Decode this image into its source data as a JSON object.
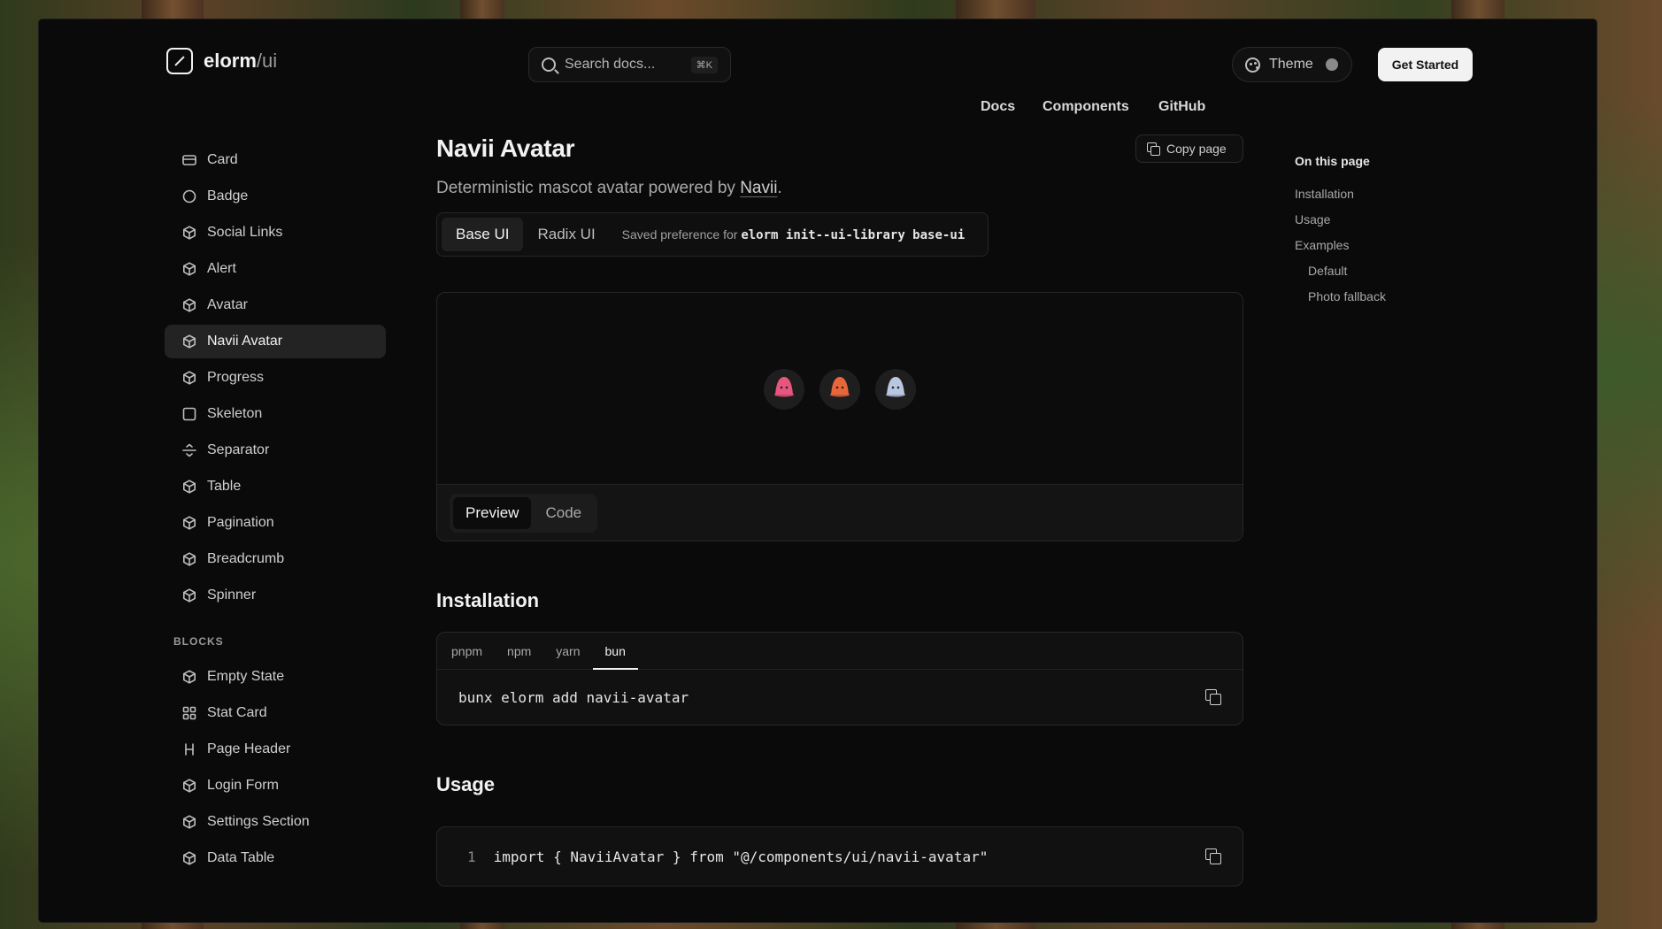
{
  "header": {
    "logo_main": "elorm",
    "logo_sub": "/ui",
    "search_placeholder": "Search docs...",
    "search_shortcut": "⌘K",
    "nav": [
      "Docs",
      "Components",
      "GitHub"
    ],
    "theme_label": "Theme",
    "cta_label": "Get Started"
  },
  "sidebar": {
    "components": [
      {
        "label": "Card",
        "icon": "card-icon"
      },
      {
        "label": "Badge",
        "icon": "circle-icon"
      },
      {
        "label": "Social Links",
        "icon": "box-icon"
      },
      {
        "label": "Alert",
        "icon": "box-icon"
      },
      {
        "label": "Avatar",
        "icon": "box-icon"
      },
      {
        "label": "Navii Avatar",
        "icon": "box-icon",
        "active": true
      },
      {
        "label": "Progress",
        "icon": "box-icon"
      },
      {
        "label": "Skeleton",
        "icon": "square-icon"
      },
      {
        "label": "Separator",
        "icon": "separator-icon"
      },
      {
        "label": "Table",
        "icon": "box-icon"
      },
      {
        "label": "Pagination",
        "icon": "box-icon"
      },
      {
        "label": "Breadcrumb",
        "icon": "box-icon"
      },
      {
        "label": "Spinner",
        "icon": "box-icon"
      }
    ],
    "blocks_title": "BLOCKS",
    "blocks": [
      {
        "label": "Empty State",
        "icon": "box-icon"
      },
      {
        "label": "Stat Card",
        "icon": "grid-icon"
      },
      {
        "label": "Page Header",
        "icon": "heading-icon"
      },
      {
        "label": "Login Form",
        "icon": "box-icon"
      },
      {
        "label": "Settings Section",
        "icon": "box-icon"
      },
      {
        "label": "Data Table",
        "icon": "box-icon"
      }
    ]
  },
  "main": {
    "title": "Navii Avatar",
    "copy_page": "Copy page",
    "description_prefix": "Deterministic mascot avatar powered by ",
    "description_link": "Navii",
    "description_suffix": ".",
    "lib_tabs": [
      "Base UI",
      "Radix UI"
    ],
    "lib_note_prefix": "Saved preference for ",
    "lib_note_cmd": "elorm init--ui-library base-ui",
    "preview_tabs": [
      "Preview",
      "Code"
    ],
    "avatars": [
      {
        "name": "pink-mascot",
        "color": "#e8557f"
      },
      {
        "name": "orange-mascot",
        "color": "#e8663a"
      },
      {
        "name": "blue-mascot",
        "color": "#b8c8e0"
      }
    ],
    "installation_title": "Installation",
    "package_managers": [
      "pnpm",
      "npm",
      "yarn",
      "bun"
    ],
    "active_pm": "bun",
    "install_command": "bunx elorm add navii-avatar",
    "usage_title": "Usage",
    "usage_line_no": "1",
    "usage_code": "import { NaviiAvatar } from \"@/components/ui/navii-avatar\""
  },
  "toc": {
    "title": "On this page",
    "items": [
      {
        "label": "Installation",
        "sub": false
      },
      {
        "label": "Usage",
        "sub": false
      },
      {
        "label": "Examples",
        "sub": false
      },
      {
        "label": "Default",
        "sub": true
      },
      {
        "label": "Photo fallback",
        "sub": true
      }
    ]
  },
  "colors": {
    "background": "#0a0a0a",
    "accent": "#f2f2f2",
    "active_item": "#232323"
  }
}
